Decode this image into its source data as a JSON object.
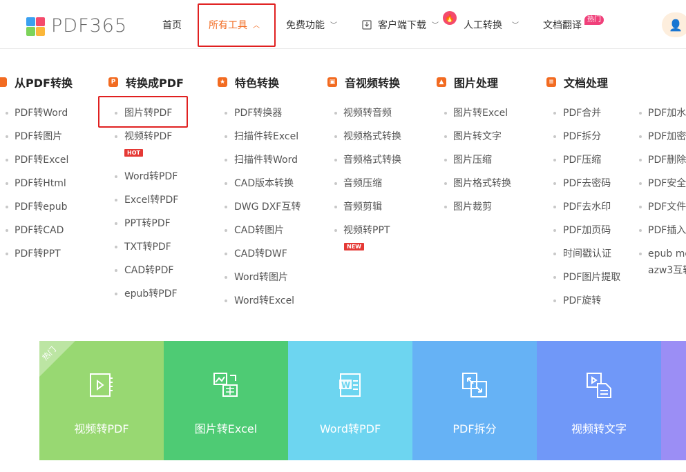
{
  "header": {
    "logo_text": "PDF365",
    "nav": [
      {
        "label": "首页"
      },
      {
        "label": "所有工具"
      },
      {
        "label": "免费功能"
      },
      {
        "label": "客户端下载"
      },
      {
        "label": "人工转换"
      },
      {
        "label": "文档翻译"
      }
    ],
    "hot_badge": "热门",
    "fire_icon": "🔥",
    "user_icon": "👤"
  },
  "columns": [
    {
      "title": "从PDF转换",
      "icon": "file-convert-icon",
      "items": [
        "PDF转Word",
        "PDF转图片",
        "PDF转Excel",
        "PDF转Html",
        "PDF转epub",
        "PDF转CAD",
        "PDF转PPT"
      ]
    },
    {
      "title": "转换成PDF",
      "icon": "to-pdf-icon",
      "items": [
        "图片转PDF",
        "视频转PDF",
        "Word转PDF",
        "Excel转PDF",
        "PPT转PDF",
        "TXT转PDF",
        "CAD转PDF",
        "epub转PDF"
      ],
      "tag": "HOT"
    },
    {
      "title": "特色转换",
      "icon": "star-shield-icon",
      "items": [
        "PDF转换器",
        "扫描件转Excel",
        "扫描件转Word",
        "CAD版本转换",
        "DWG DXF互转",
        "CAD转图片",
        "CAD转DWF",
        "Word转图片",
        "Word转Excel"
      ]
    },
    {
      "title": "音视频转换",
      "icon": "media-icon",
      "items": [
        "视频转音频",
        "视频格式转换",
        "音频格式转换",
        "音频压缩",
        "音频剪辑",
        "视频转PPT"
      ],
      "tag": "NEW"
    },
    {
      "title": "图片处理",
      "icon": "image-icon",
      "items": [
        "图片转Excel",
        "图片转文字",
        "图片压缩",
        "图片格式转换",
        "图片裁剪"
      ]
    },
    {
      "title": "文档处理",
      "icon": "document-icon",
      "items": [
        "PDF合并",
        "PDF拆分",
        "PDF压缩",
        "PDF去密码",
        "PDF去水印",
        "PDF加页码",
        "时间戳认证",
        "PDF图片提取",
        "PDF旋转"
      ]
    },
    {
      "title": "",
      "items": [
        "PDF加水",
        "PDF加密",
        "PDF删除",
        "PDF安全",
        "PDF文件",
        "PDF插入",
        "epub mo",
        "azw3互转"
      ]
    }
  ],
  "tiles": [
    {
      "label": "视频转PDF",
      "color": "#98d872",
      "icon": "video-to-pdf-icon"
    },
    {
      "label": "图片转Excel",
      "color": "#4ecb74",
      "icon": "image-to-excel-icon"
    },
    {
      "label": "Word转PDF",
      "color": "#6dd5f0",
      "icon": "word-to-pdf-icon"
    },
    {
      "label": "PDF拆分",
      "color": "#66b2f5",
      "icon": "pdf-split-icon"
    },
    {
      "label": "视频转文字",
      "color": "#7098f8",
      "icon": "video-to-text-icon"
    },
    {
      "label": "",
      "color": "#9b8ef5",
      "icon": ""
    }
  ],
  "tile_hot_label": "热门",
  "accent_color": "#f26b21"
}
